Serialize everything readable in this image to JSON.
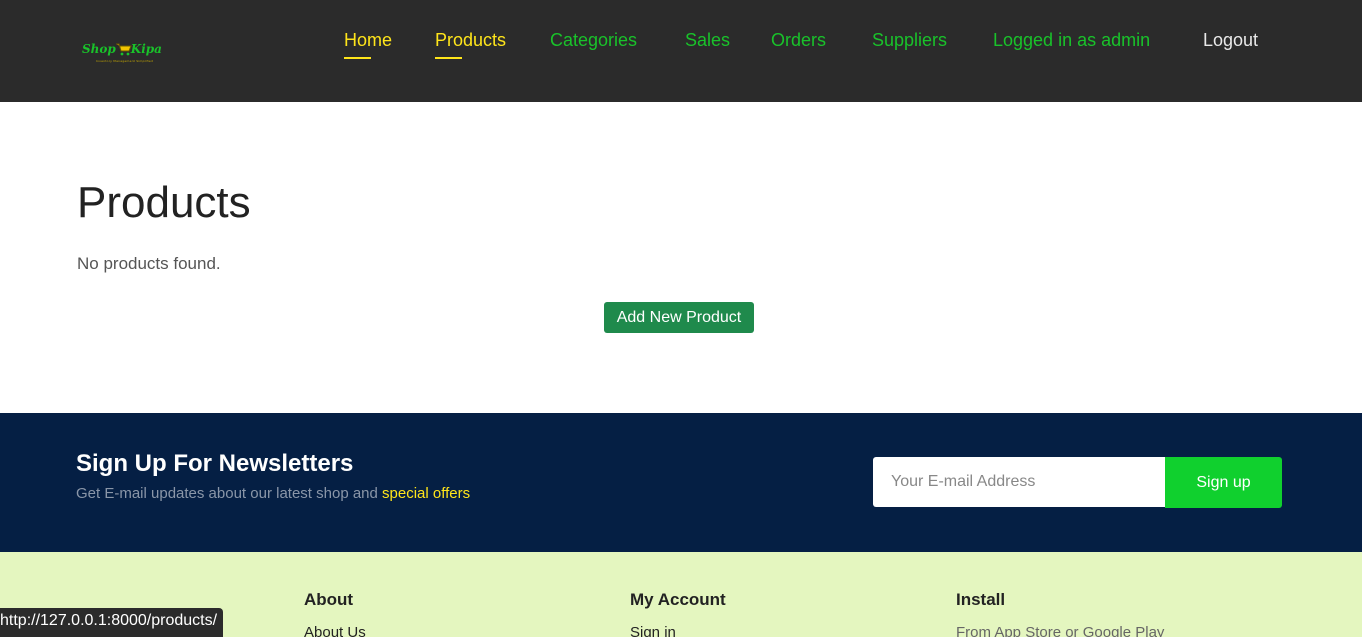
{
  "header": {
    "logo": {
      "word1": "Shop",
      "word2": "Kipa",
      "tagline": "Inventory Management Simplified",
      "icon": "shopping-cart-icon"
    },
    "nav": [
      {
        "label": "Home",
        "active": true
      },
      {
        "label": "Products",
        "active": true
      },
      {
        "label": "Categories",
        "active": false
      },
      {
        "label": "Sales",
        "active": false
      },
      {
        "label": "Orders",
        "active": false
      },
      {
        "label": "Suppliers",
        "active": false
      },
      {
        "label": "Logged in as admin",
        "active": false
      },
      {
        "label": "Logout",
        "active": false
      }
    ]
  },
  "main": {
    "title": "Products",
    "empty_message": "No products found.",
    "add_button": "Add New Product"
  },
  "newsletter": {
    "title": "Sign Up For Newsletters",
    "subtitle": "Get E-mail updates about our latest shop and ",
    "highlight": "special offers",
    "input_placeholder": "Your E-mail Address",
    "button": "Sign up"
  },
  "footer": {
    "columns": [
      {
        "heading": "About",
        "first_item": "About Us"
      },
      {
        "heading": "My Account",
        "first_item": "Sign in"
      },
      {
        "heading": "Install",
        "first_item": "From App Store or Google Play"
      }
    ]
  },
  "status_bar": {
    "url": "http://127.0.0.1:8000/products/"
  },
  "colors": {
    "header_bg": "#2b2b2b",
    "nav_green": "#19c22a",
    "nav_active_yellow": "#ffe51a",
    "add_button_bg": "#1f8a4c",
    "newsletter_bg": "#051f44",
    "signup_button_bg": "#10d02e",
    "footer_bg": "#e4f6bf"
  }
}
